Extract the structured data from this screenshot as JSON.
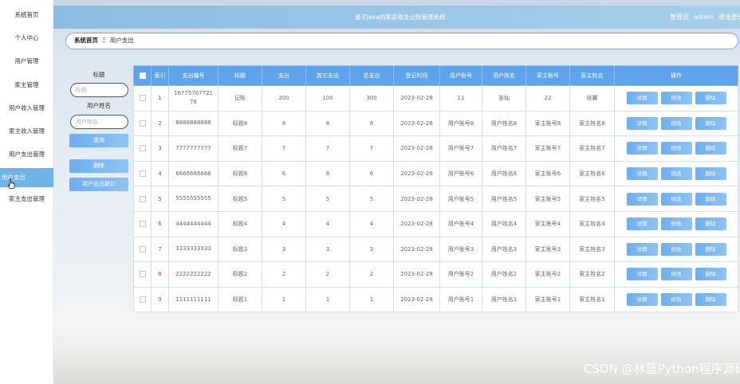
{
  "sidebar": {
    "items": [
      {
        "label": "系统首页",
        "name": "sidebar-item-home"
      },
      {
        "label": "个人中心",
        "name": "sidebar-item-profile"
      },
      {
        "label": "用户管理",
        "name": "sidebar-item-user-mgmt"
      },
      {
        "label": "家主管理",
        "name": "sidebar-item-owner-mgmt"
      },
      {
        "label": "用户收入管理",
        "name": "sidebar-item-user-income"
      },
      {
        "label": "家主收入管理",
        "name": "sidebar-item-owner-income"
      },
      {
        "label": "用户支出管理",
        "name": "sidebar-item-user-expense-mgmt"
      },
      {
        "label": "用户支出",
        "name": "sidebar-item-user-expense"
      },
      {
        "label": "家主支出管理",
        "name": "sidebar-item-owner-expense"
      }
    ]
  },
  "header": {
    "title": "基于Java的家庭收支记账管理系统",
    "role": "管理员",
    "user": "admin",
    "logout": "退出登录"
  },
  "breadcrumb": {
    "home": "系统首页",
    "separator": "Ξ",
    "current": "用户支出"
  },
  "search": {
    "title_label": "标题",
    "title_placeholder": "标题",
    "name_label": "用户姓名",
    "name_placeholder": "用户姓名",
    "query_button": "查询",
    "delete_button": "删除",
    "stats_button": "用户支出统计"
  },
  "table": {
    "columns": [
      "索引",
      "支出编号",
      "标题",
      "支出",
      "其它支出",
      "总支出",
      "登记时间",
      "用户账号",
      "用户姓名",
      "家主账号",
      "家主姓名",
      "操作"
    ],
    "rows": [
      [
        "1",
        "1677576772178",
        "记账",
        "200",
        "100",
        "300",
        "2023-02-28",
        "11",
        "张灿",
        "22",
        "张翼"
      ],
      [
        "2",
        "8888888888",
        "标题8",
        "8",
        "8",
        "8",
        "2023-02-28",
        "用户账号8",
        "用户姓名8",
        "家主账号8",
        "家主姓名8"
      ],
      [
        "3",
        "7777777777",
        "标题7",
        "7",
        "7",
        "7",
        "2023-02-28",
        "用户账号7",
        "用户姓名7",
        "家主账号7",
        "家主姓名7"
      ],
      [
        "4",
        "6666666666",
        "标题6",
        "6",
        "6",
        "6",
        "2023-02-28",
        "用户账号6",
        "用户姓名6",
        "家主账号6",
        "家主姓名6"
      ],
      [
        "5",
        "5555555555",
        "标题5",
        "5",
        "5",
        "5",
        "2023-02-28",
        "用户账号5",
        "用户姓名5",
        "家主账号5",
        "家主姓名5"
      ],
      [
        "6",
        "4444444444",
        "标题4",
        "4",
        "4",
        "4",
        "2023-02-28",
        "用户账号4",
        "用户姓名4",
        "家主账号4",
        "家主姓名4"
      ],
      [
        "7",
        "3333333333",
        "标题3",
        "3",
        "3",
        "3",
        "2023-02-28",
        "用户账号3",
        "用户姓名3",
        "家主账号3",
        "家主姓名3"
      ],
      [
        "8",
        "2222222222",
        "标题2",
        "2",
        "2",
        "2",
        "2023-02-28",
        "用户账号2",
        "用户姓名2",
        "家主账号2",
        "家主姓名2"
      ],
      [
        "9",
        "1111111111",
        "标题1",
        "1",
        "1",
        "1",
        "2023-02-28",
        "用户账号1",
        "用户姓名1",
        "家主账号1",
        "家主姓名1"
      ]
    ],
    "actions": {
      "detail": "详情",
      "edit": "修改",
      "delete": "删除"
    }
  },
  "watermark": "CSDN @林蓝Python程序源码",
  "colors": {
    "accent": "#5fa3ea",
    "header_gradient_start": "#8bbde3",
    "active_sidebar": "#6fb3e8"
  },
  "icons": {
    "cursor": "hand-pointer-icon"
  }
}
